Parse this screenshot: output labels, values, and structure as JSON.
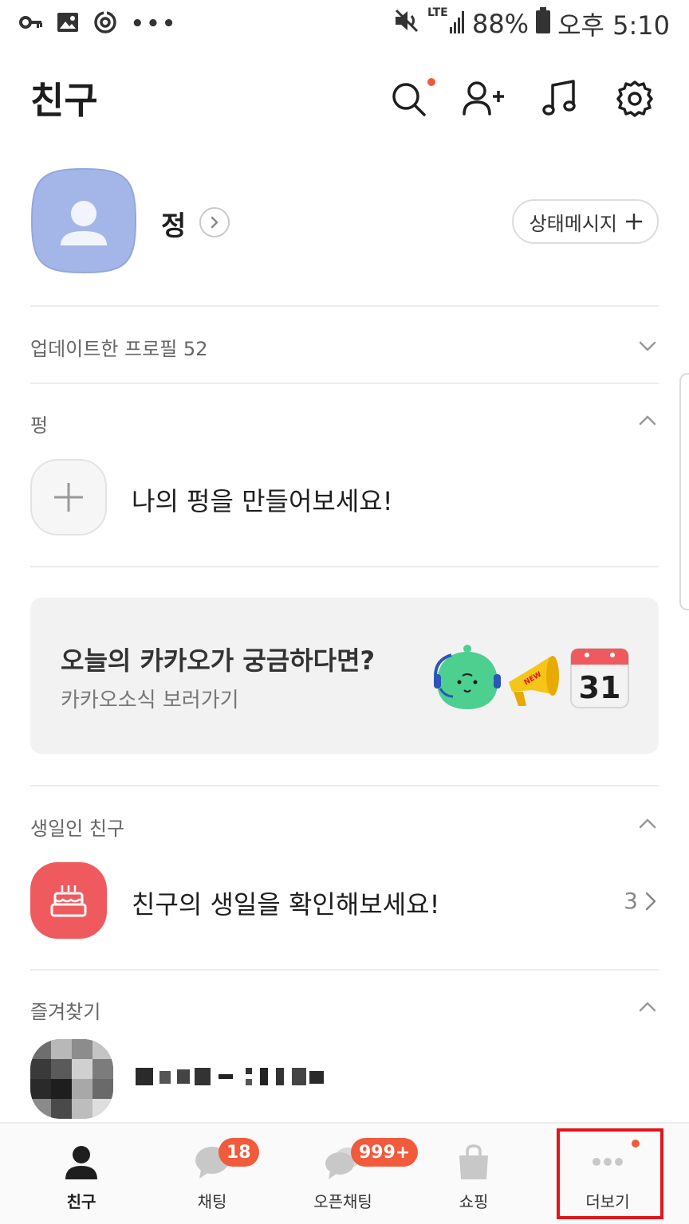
{
  "status_bar": {
    "battery": "88%",
    "network": "LTE",
    "time": "오후 5:10"
  },
  "header": {
    "title": "친구"
  },
  "profile": {
    "name": "정",
    "status_button_label": "상태메시지"
  },
  "updated_profiles": {
    "label": "업데이트한 프로필",
    "count": "52"
  },
  "pung": {
    "section_title": "펑",
    "cta_text": "나의 펑을 만들어보세요!"
  },
  "banner": {
    "title": "오늘의 카카오가 궁금하다면?",
    "subtitle": "카카오소식 보러가기",
    "calendar_number": "31",
    "megaphone_label": "NEW"
  },
  "birthday": {
    "section_title": "생일인 친구",
    "cta_text": "친구의 생일을 확인해보세요!",
    "count": "3"
  },
  "favorites": {
    "section_title": "즐겨찾기"
  },
  "tabs": [
    {
      "label": "친구",
      "badge": ""
    },
    {
      "label": "채팅",
      "badge": "18"
    },
    {
      "label": "오픈채팅",
      "badge": "999+"
    },
    {
      "label": "쇼핑",
      "badge": ""
    },
    {
      "label": "더보기",
      "badge": ""
    }
  ],
  "colors": {
    "accent_badge": "#f15a3b",
    "birthday_icon_bg": "#ef5a5f",
    "avatar_bg": "#a4b6e8",
    "highlight_box": "#e0161c"
  }
}
